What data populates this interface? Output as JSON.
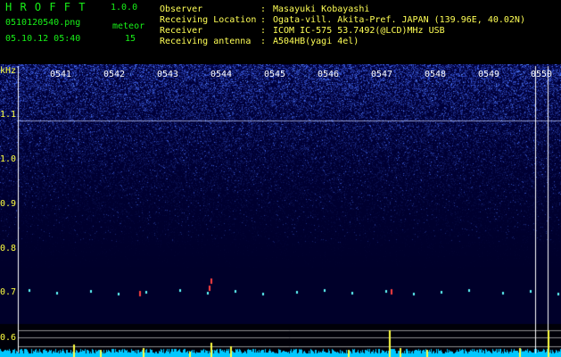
{
  "header": {
    "title": "H R O F F T",
    "version": "1.0.0",
    "filename": "0510120540.png",
    "detector": "meteor",
    "datetime": "05.10.12 05:40",
    "count": "15",
    "fields": [
      {
        "label": "Observer",
        "sep": ":",
        "value": "Masayuki Kobayashi"
      },
      {
        "label": "Receiving Location",
        "sep": ":",
        "value": "Ogata-vill. Akita-Pref. JAPAN (139.96E, 40.02N)"
      },
      {
        "label": "Receiver",
        "sep": ":",
        "value": "ICOM IC-575 53.7492(@LCD)MHz USB"
      },
      {
        "label": "Receiving antenna",
        "sep": ":",
        "value": "A504HB(yagi 4el)"
      }
    ]
  },
  "axis": {
    "unit": "kHz",
    "y_ticks": [
      "1.1",
      "1.0",
      "0.9",
      "0.8",
      "0.7",
      "0.6"
    ],
    "x_ticks": [
      "0541",
      "0542",
      "0543",
      "0544",
      "0545",
      "0546",
      "0547",
      "0548",
      "0549",
      "0550"
    ]
  },
  "colors": {
    "background": "#000000",
    "spectrogram_noise": "#2b4dff",
    "axis_labels": "#ffff40",
    "title_green": "#18f018",
    "trace": "#00e0ff"
  }
}
